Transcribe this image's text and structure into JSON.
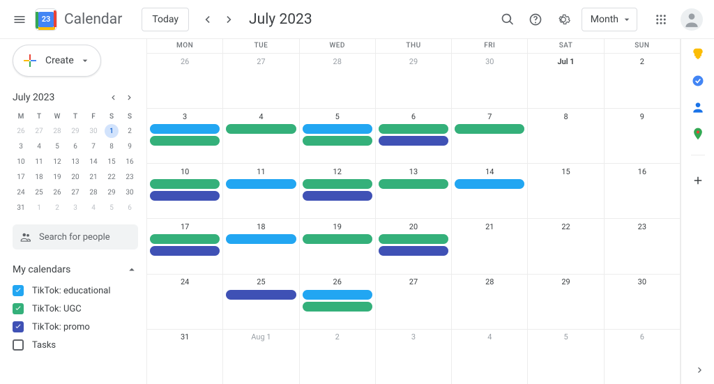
{
  "header": {
    "app_name": "Calendar",
    "logo_day": "23",
    "today_label": "Today",
    "title": "July 2023",
    "view_label": "Month"
  },
  "sidebar": {
    "create_label": "Create",
    "mini_title": "July 2023",
    "mini_dow": [
      "M",
      "T",
      "W",
      "T",
      "F",
      "S",
      "S"
    ],
    "mini_days": [
      {
        "n": "26",
        "dim": true
      },
      {
        "n": "27",
        "dim": true
      },
      {
        "n": "28",
        "dim": true
      },
      {
        "n": "29",
        "dim": true
      },
      {
        "n": "30",
        "dim": true
      },
      {
        "n": "1",
        "today": true
      },
      {
        "n": "2"
      },
      {
        "n": "3"
      },
      {
        "n": "4"
      },
      {
        "n": "5"
      },
      {
        "n": "6"
      },
      {
        "n": "7"
      },
      {
        "n": "8"
      },
      {
        "n": "9"
      },
      {
        "n": "10"
      },
      {
        "n": "11"
      },
      {
        "n": "12"
      },
      {
        "n": "13"
      },
      {
        "n": "14"
      },
      {
        "n": "15"
      },
      {
        "n": "16"
      },
      {
        "n": "17"
      },
      {
        "n": "18"
      },
      {
        "n": "19"
      },
      {
        "n": "20"
      },
      {
        "n": "21"
      },
      {
        "n": "22"
      },
      {
        "n": "23"
      },
      {
        "n": "24"
      },
      {
        "n": "25"
      },
      {
        "n": "26"
      },
      {
        "n": "27"
      },
      {
        "n": "28"
      },
      {
        "n": "29"
      },
      {
        "n": "30"
      },
      {
        "n": "31"
      },
      {
        "n": "1",
        "dim": true
      },
      {
        "n": "2",
        "dim": true
      },
      {
        "n": "3",
        "dim": true
      },
      {
        "n": "4",
        "dim": true
      },
      {
        "n": "5",
        "dim": true
      },
      {
        "n": "6",
        "dim": true
      }
    ],
    "search_placeholder": "Search for people",
    "my_cals_label": "My calendars",
    "calendars": [
      {
        "label": "TikTok: educational",
        "color": "#22a6f2",
        "checked": true
      },
      {
        "label": "TikTok: UGC",
        "color": "#34b07a",
        "checked": true
      },
      {
        "label": "TikTok: promo",
        "color": "#3f51b5",
        "checked": true
      },
      {
        "label": "Tasks",
        "color": "#5f6368",
        "checked": false
      }
    ]
  },
  "grid": {
    "dow": [
      "MON",
      "TUE",
      "WED",
      "THU",
      "FRI",
      "SAT",
      "SUN"
    ],
    "weeks": [
      [
        {
          "d": "26",
          "dim": true,
          "ev": []
        },
        {
          "d": "27",
          "dim": true,
          "ev": []
        },
        {
          "d": "28",
          "dim": true,
          "ev": []
        },
        {
          "d": "29",
          "dim": true,
          "ev": []
        },
        {
          "d": "30",
          "dim": true,
          "ev": []
        },
        {
          "d": "Jul 1",
          "bold": true,
          "ev": []
        },
        {
          "d": "2",
          "ev": []
        }
      ],
      [
        {
          "d": "3",
          "ev": [
            "blue",
            "green"
          ]
        },
        {
          "d": "4",
          "ev": [
            "green"
          ]
        },
        {
          "d": "5",
          "ev": [
            "blue",
            "green"
          ]
        },
        {
          "d": "6",
          "ev": [
            "green",
            "indigo"
          ]
        },
        {
          "d": "7",
          "ev": [
            "green"
          ]
        },
        {
          "d": "8",
          "ev": []
        },
        {
          "d": "9",
          "ev": []
        }
      ],
      [
        {
          "d": "10",
          "ev": [
            "green",
            "indigo"
          ]
        },
        {
          "d": "11",
          "ev": [
            "blue"
          ]
        },
        {
          "d": "12",
          "ev": [
            "green",
            "indigo"
          ]
        },
        {
          "d": "13",
          "ev": [
            "green"
          ]
        },
        {
          "d": "14",
          "ev": [
            "blue"
          ]
        },
        {
          "d": "15",
          "ev": []
        },
        {
          "d": "16",
          "ev": []
        }
      ],
      [
        {
          "d": "17",
          "ev": [
            "green",
            "indigo"
          ]
        },
        {
          "d": "18",
          "ev": [
            "blue"
          ]
        },
        {
          "d": "19",
          "ev": [
            "green"
          ]
        },
        {
          "d": "20",
          "ev": [
            "green",
            "indigo"
          ]
        },
        {
          "d": "21",
          "ev": []
        },
        {
          "d": "22",
          "ev": []
        },
        {
          "d": "23",
          "ev": []
        }
      ],
      [
        {
          "d": "24",
          "ev": []
        },
        {
          "d": "25",
          "ev": [
            "indigo"
          ]
        },
        {
          "d": "26",
          "ev": [
            "blue",
            "green"
          ]
        },
        {
          "d": "27",
          "ev": []
        },
        {
          "d": "28",
          "ev": []
        },
        {
          "d": "29",
          "ev": []
        },
        {
          "d": "30",
          "ev": []
        }
      ],
      [
        {
          "d": "31",
          "ev": []
        },
        {
          "d": "Aug 1",
          "dim": true,
          "ev": []
        },
        {
          "d": "2",
          "dim": true,
          "ev": []
        },
        {
          "d": "3",
          "dim": true,
          "ev": []
        },
        {
          "d": "4",
          "dim": true,
          "ev": []
        },
        {
          "d": "5",
          "dim": true,
          "ev": []
        },
        {
          "d": "6",
          "dim": true,
          "ev": []
        }
      ]
    ]
  },
  "right_panel": {
    "icons": [
      "keep",
      "tasks",
      "contacts",
      "maps"
    ]
  }
}
